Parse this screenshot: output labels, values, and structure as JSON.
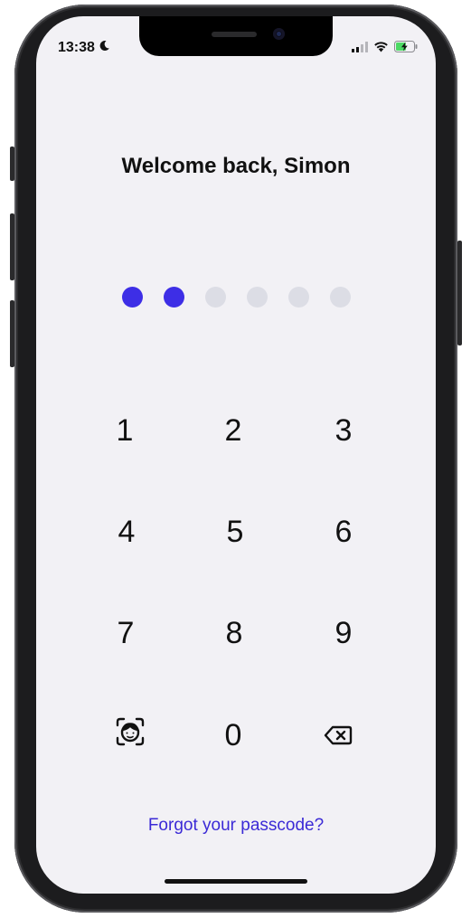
{
  "status_bar": {
    "time": "13:38",
    "moon_icon": "moon-icon",
    "signal_icon": "signal-icon",
    "wifi_icon": "wifi-icon",
    "battery_icon": "battery-charging-icon"
  },
  "lock": {
    "title": "Welcome back, Simon",
    "passcode_length": 6,
    "digits_entered": 2,
    "filled_color": "#3d2ee6",
    "empty_color": "#dcdde5"
  },
  "keypad": {
    "keys": [
      "1",
      "2",
      "3",
      "4",
      "5",
      "6",
      "7",
      "8",
      "9",
      "0"
    ],
    "faceid_icon": "face-id-icon",
    "delete_icon": "backspace-icon"
  },
  "footer": {
    "forgot_label": "Forgot your passcode?",
    "link_color": "#3b2ad6"
  }
}
